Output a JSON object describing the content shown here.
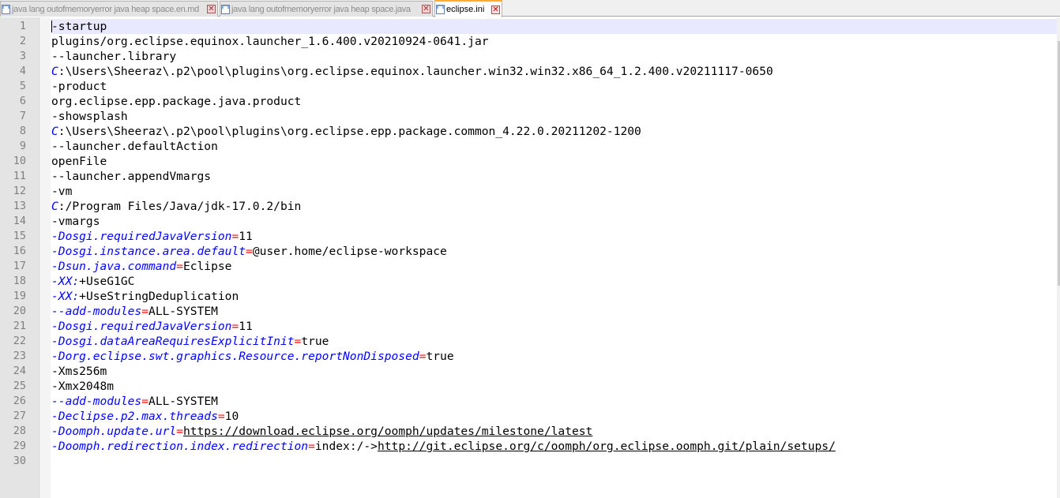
{
  "tabs": [
    {
      "label": "java lang outofmemoryerror java heap space.en.md",
      "active": false
    },
    {
      "label": "java lang outofmemoryerror java heap space.java",
      "active": false
    },
    {
      "label": "eclipse.ini",
      "active": true
    }
  ],
  "close_glyph": "✕",
  "editor": {
    "current_line": 1,
    "lines": [
      "-startup",
      "plugins/org.eclipse.equinox.launcher_1.6.400.v20210924-0641.jar",
      "--launcher.library",
      "C:\\Users\\Sheeraz\\.p2\\pool\\plugins\\org.eclipse.equinox.launcher.win32.win32.x86_64_1.2.400.v20211117-0650",
      "-product",
      "org.eclipse.epp.package.java.product",
      "-showsplash",
      "C:\\Users\\Sheeraz\\.p2\\pool\\plugins\\org.eclipse.epp.package.common_4.22.0.20211202-1200",
      "--launcher.defaultAction",
      "openFile",
      "--launcher.appendVmargs",
      "-vm",
      "C:/Program Files/Java/jdk-17.0.2/bin",
      "-vmargs",
      "-Dosgi.requiredJavaVersion=11",
      "-Dosgi.instance.area.default=@user.home/eclipse-workspace",
      "-Dsun.java.command=Eclipse",
      "-XX:+UseG1GC",
      "-XX:+UseStringDeduplication",
      "--add-modules=ALL-SYSTEM",
      "-Dosgi.requiredJavaVersion=11",
      "-Dosgi.dataAreaRequiresExplicitInit=true",
      "-Dorg.eclipse.swt.graphics.Resource.reportNonDisposed=true",
      "-Xms256m",
      "-Xmx2048m",
      "--add-modules=ALL-SYSTEM",
      "-Declipse.p2.max.threads=10",
      "-Doomph.update.url=https://download.eclipse.org/oomph/updates/milestone/latest",
      "-Doomph.redirection.index.redirection=index:/->http://git.eclipse.org/c/oomph/org.eclipse.oomph.git/plain/setups/",
      ""
    ]
  },
  "colors": {
    "key": "#0000ff",
    "equals": "#ff0000",
    "line_number": "#808080",
    "current_line_bg": "#e8e8ff",
    "active_tab_accent": "#f9ab3d"
  }
}
